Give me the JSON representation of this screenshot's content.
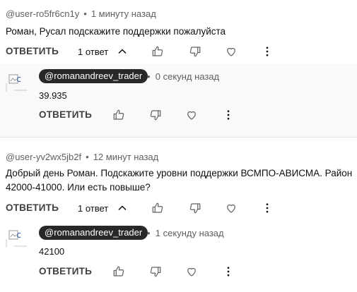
{
  "threads": [
    {
      "author": "@user-ro5fr6cn1y",
      "time": "1 минуту назад",
      "text": "Роман, Русал подскажите поддержки пожалуйста",
      "reply_label": "ОТВЕТИТЬ",
      "replies_count": "1 ответ",
      "reply": {
        "author": "@romanandreev_trader",
        "time": "0 секунд назад",
        "text": "39.935",
        "reply_label": "ОТВЕТИТЬ"
      }
    },
    {
      "author": "@user-yv2wx5jb2f",
      "time": "12 минут назад",
      "text": "Добрый день Роман. Подскажите уровни поддержки ВСМПО-АВИСМА. Район 42000-41000. Или есть повыше?",
      "reply_label": "ОТВЕТИТЬ",
      "replies_count": "1 ответ",
      "reply": {
        "author": "@romanandreev_trader",
        "time": "1 секунду назад",
        "text": "42100",
        "reply_label": "ОТВЕТИТЬ"
      }
    }
  ],
  "icons": {
    "like": "thumbs-up-icon",
    "dislike": "thumbs-down-icon",
    "heart": "heart-icon",
    "more": "more-vert-icon",
    "collapse": "chevron-up-icon"
  },
  "colors": {
    "handle_pill_bg": "#282828",
    "muted_text": "#606060",
    "reply_bg": "#f9f9f9"
  }
}
